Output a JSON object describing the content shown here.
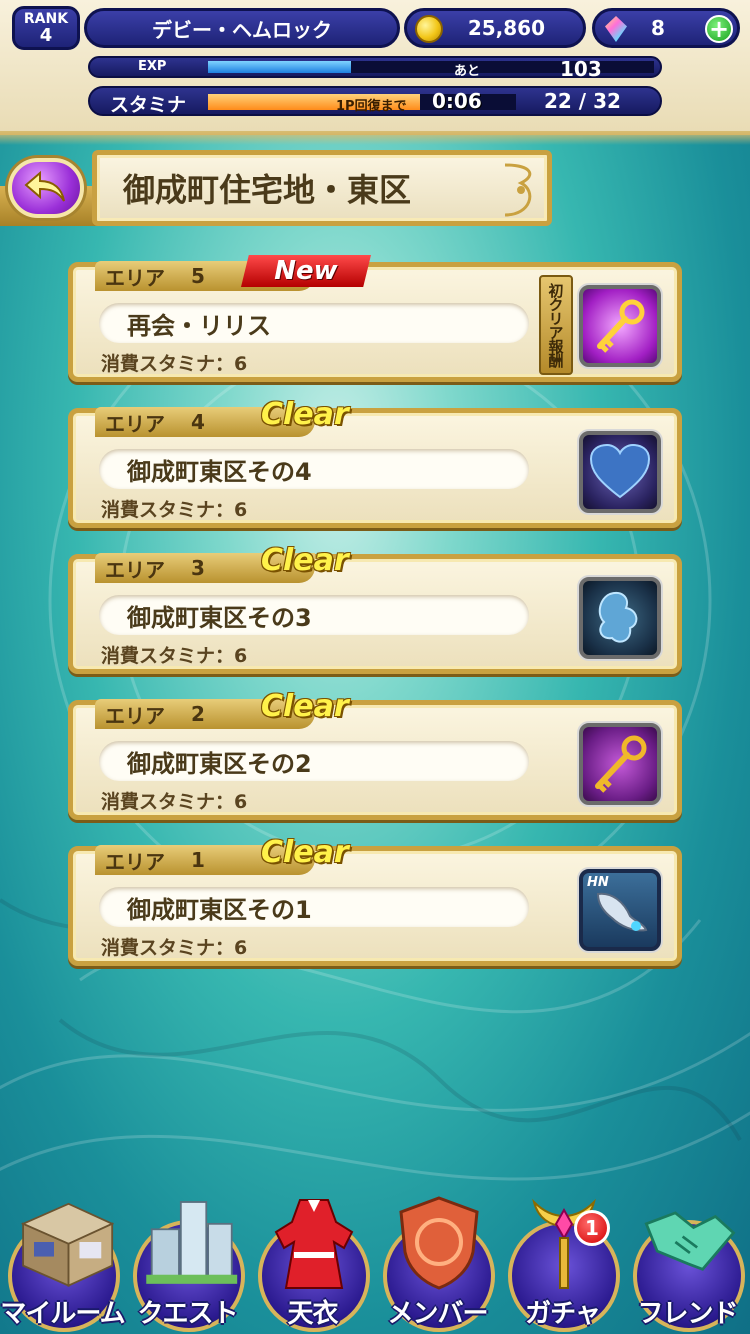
{
  "hud": {
    "rank_label": "RANK",
    "rank_value": "4",
    "player_name": "デビー・ヘムロック",
    "coins": "25,860",
    "gems": "8",
    "plus_label": "+",
    "exp_label": "EXP",
    "exp_remaining_prefix": "あと",
    "exp_remaining": "103",
    "exp_progress": 0.32,
    "stamina_label": "スタミナ",
    "stamina_recover_label": "1P回復まで",
    "stamina_timer": "0:06",
    "stamina_value": "22 / 32",
    "stamina_progress": 0.6875
  },
  "title": {
    "text": "御成町住宅地・東区"
  },
  "quests": [
    {
      "area_label": "エリア",
      "area_num": "5",
      "badge": "New",
      "name": "再会・リリス",
      "cost": "消費スタミナ：6",
      "first_clear": "初クリア報酬",
      "reward_icon": "golden-key-icon"
    },
    {
      "area_label": "エリア",
      "area_num": "4",
      "badge": "Clear",
      "name": "御成町東区その4",
      "cost": "消費スタミナ：6",
      "reward_icon": "heart-pendant-icon"
    },
    {
      "area_label": "エリア",
      "area_num": "3",
      "badge": "Clear",
      "name": "御成町東区その3",
      "cost": "消費スタミナ：6",
      "reward_icon": "blue-charm-icon"
    },
    {
      "area_label": "エリア",
      "area_num": "2",
      "badge": "Clear",
      "name": "御成町東区その2",
      "cost": "消費スタミナ：6",
      "reward_icon": "golden-key-icon"
    },
    {
      "area_label": "エリア",
      "area_num": "1",
      "badge": "Clear",
      "name": "御成町東区その1",
      "cost": "消費スタミナ：6",
      "reward_icon": "wing-charm-icon",
      "reward_tag": "HN"
    }
  ],
  "nav": {
    "items": [
      {
        "label": "マイルーム",
        "icon": "room-icon"
      },
      {
        "label": "クエスト",
        "icon": "city-icon"
      },
      {
        "label": "天衣",
        "icon": "dress-icon"
      },
      {
        "label": "メンバー",
        "icon": "shield-emblem-icon"
      },
      {
        "label": "ガチャ",
        "icon": "wand-icon",
        "badge": "1"
      },
      {
        "label": "フレンド",
        "icon": "handshake-icon"
      }
    ]
  },
  "colors": {
    "gold": "#c9a140",
    "navy": "#1e2377",
    "new_red": "#d30000",
    "clear_yellow": "#fff24a"
  }
}
